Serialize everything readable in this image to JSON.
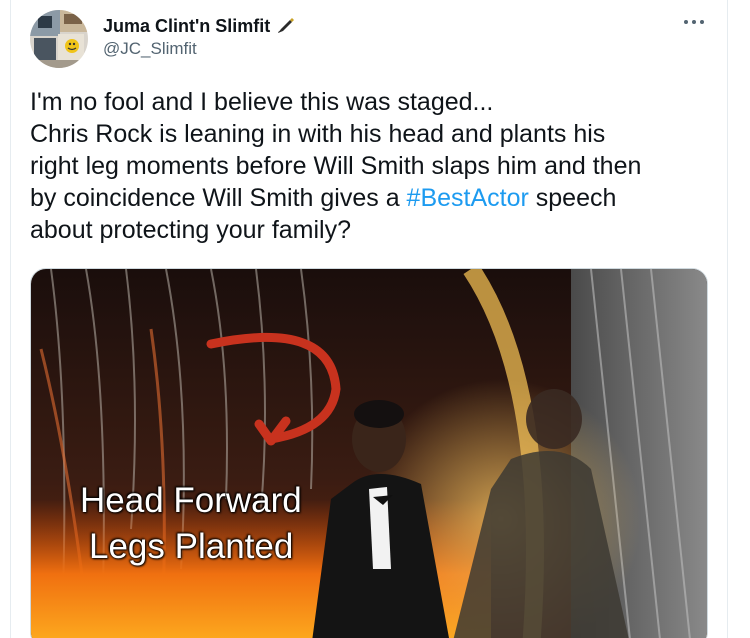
{
  "tweet": {
    "author": {
      "display_name": "Juma Clint'n Slimfit",
      "handle": "@JC_Slimfit",
      "name_icon": "fountain-pen-icon",
      "avatar_icon": "avatar-collage"
    },
    "more_icon": "ellipsis-icon",
    "text_lines": [
      "I'm no fool and I believe this was staged...",
      "Chris Rock is leaning in with his head and plants his",
      "right leg moments before Will Smith slaps him and then"
    ],
    "text_line4_before": "by coincidence Will Smith gives a ",
    "hashtag": "#BestActor",
    "text_line4_after": " speech",
    "text_line5": "about protecting your family?",
    "media": {
      "caption_line1": "Head Forward",
      "caption_line2": "Legs Planted",
      "annotation_icon": "red-curved-arrow-icon"
    }
  },
  "colors": {
    "text": "#0f1419",
    "secondary": "#536471",
    "link": "#1d9bf0",
    "annotation": "#c8321e"
  }
}
